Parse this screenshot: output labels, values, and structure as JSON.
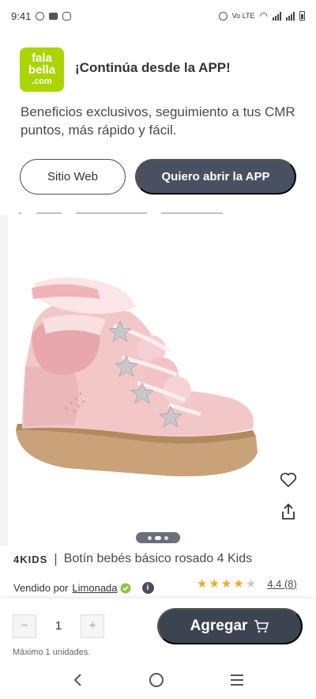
{
  "status_bar": {
    "time": "9:41",
    "network_label": "Vo LTE"
  },
  "banner": {
    "logo_line1": "fala",
    "logo_line2": "bella",
    "logo_line3": ".com",
    "title": "¡Continúa desde la APP!",
    "text": "Beneficios exclusivos, seguimiento a tus CMR puntos, más rápido y fácil.",
    "web_button": "Sitio Web",
    "app_button": "Quiero abrir la APP"
  },
  "product": {
    "brand": "4KIDS",
    "separator": "|",
    "name": "Botín bebés básico rosado 4 Kids",
    "seller_prefix": "Vendido por",
    "seller_name": "Limonada",
    "info_icon_text": "i",
    "rating_value": 4.4,
    "rating_text": "4.4 (8)",
    "stars": [
      "full",
      "full",
      "full",
      "full",
      "off"
    ],
    "image_pager": {
      "count": 3,
      "active": 1
    }
  },
  "cart": {
    "minus": "−",
    "quantity": "1",
    "plus": "+",
    "max_text": "Máximo 1 unidades.",
    "add_button": "Agregar"
  },
  "icons": {
    "favorite": "heart-icon",
    "share": "share-icon",
    "cart": "cart-icon",
    "back": "back-icon",
    "home": "home-icon",
    "recents": "menu-icon"
  },
  "colors": {
    "brand_green": "#aad500",
    "primary_dark": "#495061",
    "star": "#f5a623",
    "verified": "#8ec63f"
  }
}
